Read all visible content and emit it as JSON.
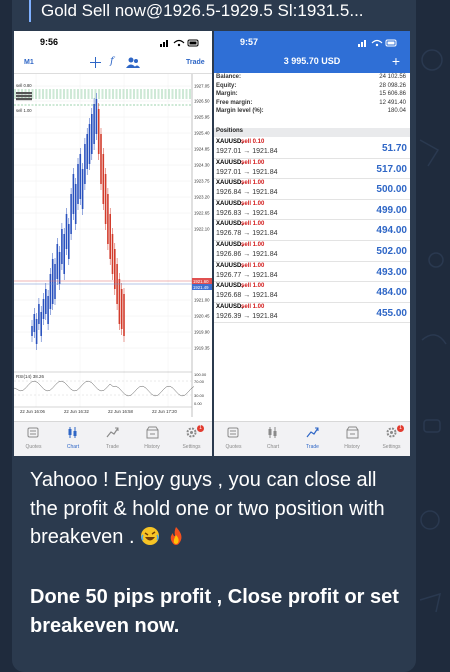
{
  "quote": {
    "text": "Gold Sell now@1926.5-1929.5  Sl:1931.5..."
  },
  "left_screen": {
    "time": "9:56",
    "timeframe": "M1",
    "trade_label": "Trade",
    "fx_icon": "f",
    "sell_labels": [
      "sell 0.80",
      "sell 1.00"
    ],
    "price_axis": [
      "1927.05",
      "1926.50",
      "1925.95",
      "1925.40",
      "1924.85",
      "1924.30",
      "1923.75",
      "1923.20",
      "1922.65",
      "1922.10",
      "1921.60",
      "1921.49",
      "1921.00",
      "1920.45",
      "1919.90",
      "1919.35"
    ],
    "bid_price": "1921.60",
    "ask_price": "1921.49",
    "time_axis": [
      "22 Jun 16:06",
      "22 Jun 16:32",
      "22 Jun 16:58",
      "22 Jun 17:20"
    ],
    "rsi_label": "RSI(14) 38.26",
    "rsi_axis": [
      "100.00",
      "70.00",
      "30.00",
      "0.00"
    ],
    "tabs": [
      {
        "label": "Quotes",
        "icon": "quotes-icon",
        "active": false
      },
      {
        "label": "Chart",
        "icon": "chart-icon",
        "active": true
      },
      {
        "label": "Trade",
        "icon": "trade-icon",
        "active": false
      },
      {
        "label": "History",
        "icon": "history-icon",
        "active": false
      },
      {
        "label": "Settings",
        "icon": "settings-icon",
        "active": false,
        "badge": "1"
      }
    ]
  },
  "right_screen": {
    "time": "9:57",
    "balance_title": "3 995.70 USD",
    "account": [
      {
        "label": "Balance:",
        "value": "24 102.56"
      },
      {
        "label": "Equity:",
        "value": "28 098.26"
      },
      {
        "label": "Margin:",
        "value": "15 606.86"
      },
      {
        "label": "Free margin:",
        "value": "12 491.40"
      },
      {
        "label": "Margin level (%):",
        "value": "180.04"
      }
    ],
    "positions_header": "Positions",
    "positions": [
      {
        "symbol": "XAUUSD,",
        "dir": "sell 0.10",
        "prices": "1927.01 → 1921.84",
        "profit": "51.70"
      },
      {
        "symbol": "XAUUSD,",
        "dir": "sell 1.00",
        "prices": "1927.01 → 1921.84",
        "profit": "517.00"
      },
      {
        "symbol": "XAUUSD,",
        "dir": "sell 1.00",
        "prices": "1926.84 → 1921.84",
        "profit": "500.00"
      },
      {
        "symbol": "XAUUSD,",
        "dir": "sell 1.00",
        "prices": "1926.83 → 1921.84",
        "profit": "499.00"
      },
      {
        "symbol": "XAUUSD,",
        "dir": "sell 1.00",
        "prices": "1926.78 → 1921.84",
        "profit": "494.00"
      },
      {
        "symbol": "XAUUSD,",
        "dir": "sell 1.00",
        "prices": "1926.86 → 1921.84",
        "profit": "502.00"
      },
      {
        "symbol": "XAUUSD,",
        "dir": "sell 1.00",
        "prices": "1926.77 → 1921.84",
        "profit": "493.00"
      },
      {
        "symbol": "XAUUSD,",
        "dir": "sell 1.00",
        "prices": "1926.68 → 1921.84",
        "profit": "484.00"
      },
      {
        "symbol": "XAUUSD,",
        "dir": "sell 1.00",
        "prices": "1926.39 → 1921.84",
        "profit": "455.00"
      }
    ],
    "tabs": [
      {
        "label": "Quotes",
        "icon": "quotes-icon",
        "active": false
      },
      {
        "label": "Chart",
        "icon": "chart-icon",
        "active": false
      },
      {
        "label": "Trade",
        "icon": "trade-icon",
        "active": true
      },
      {
        "label": "History",
        "icon": "history-icon",
        "active": false
      },
      {
        "label": "Settings",
        "icon": "settings-icon",
        "active": false,
        "badge": "1"
      }
    ]
  },
  "message": {
    "line1": "Yahooo ! Enjoy guys , you can close all the profit & hold one or two position with breakeven .",
    "emoji1": "rofl-emoji",
    "emoji2": "fire-emoji",
    "line2": "Done 50 pips profit , Close profit or set breakeven now."
  },
  "colors": {
    "accent": "#2e66c6",
    "sell_red": "#d21b1b",
    "bubble": "#2b3a4e",
    "background": "#1f2b3d"
  }
}
